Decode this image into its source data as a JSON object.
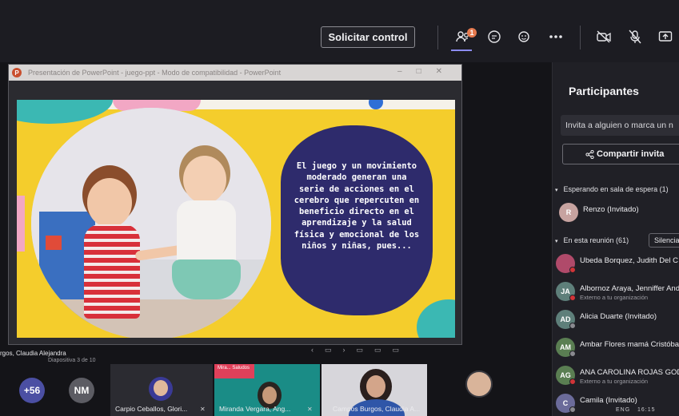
{
  "toolbar": {
    "request_control_label": "Solicitar control",
    "participants_badge": "1",
    "icons": [
      "people-icon",
      "chat-icon",
      "reactions-icon",
      "more-icon",
      "camera-off-icon",
      "mic-off-icon",
      "share-icon"
    ]
  },
  "powerpoint": {
    "title": "Presentación de PowerPoint - juego-ppt - Modo de compatibilidad - PowerPoint",
    "slide_text": "El juego y un movimiento moderado generan una serie de acciones en el cerebro que repercuten en beneficio directo en el aprendizaje y la salud física y emocional de los niños y niñas, pues...",
    "slide_counter": "Diapositiva 3 de 10",
    "presenter_name": "rgos, Claudia Alejandra"
  },
  "panel": {
    "title": "Participantes",
    "invite_placeholder": "Invita a alguien o marca un n",
    "share_invite_label": "Compartir invita",
    "waiting_section": "Esperando en sala de espera (1)",
    "in_meeting_section": "En esta reunión (61)",
    "mute_all_label": "Silencia",
    "waiting": [
      {
        "initials": "R",
        "name": "Renzo (Invitado)",
        "color": "#c7a3a0"
      }
    ],
    "participants": [
      {
        "initials": "",
        "name": "Ubeda Borquez, Judith Del C",
        "sub": "",
        "color": "#b04a6a",
        "presence": "#d13438"
      },
      {
        "initials": "JA",
        "name": "Albornoz Araya, Jenniffer And",
        "sub": "Externo a tu organización",
        "color": "#5e7f7a",
        "presence": "#d13438"
      },
      {
        "initials": "AD",
        "name": "Alicia Duarte (Invitado)",
        "sub": "",
        "color": "#5e7f7a",
        "presence": "#8a8a90"
      },
      {
        "initials": "AM",
        "name": "Ambar Flores mamá Cristóbal...",
        "sub": "",
        "color": "#5a7e52",
        "presence": "#8a8a90"
      },
      {
        "initials": "AG",
        "name": "ANA CAROLINA ROJAS GODOY",
        "sub": "Externo a tu organización",
        "color": "#5a7e52",
        "presence": "#d13438"
      },
      {
        "initials": "C",
        "name": "Camila (Invitado)",
        "sub": "",
        "color": "#6b6b9a",
        "presence": "#8a8a90"
      }
    ]
  },
  "strip": {
    "overflow_count": "+56",
    "nm_initials": "NM",
    "tiles": [
      {
        "name": "Carpio Ceballos, Glori..."
      },
      {
        "name": "Miranda Vergara, Ang..."
      },
      {
        "name": "Campos Burgos, Claudia A..."
      }
    ],
    "video_label": "Mira... Saludos"
  },
  "taskbar": {
    "lang": "ENG",
    "time": "16:15"
  },
  "colors": {
    "accent": "#8c8cf2",
    "slide_yellow": "#f4cd2c",
    "bubble_navy": "#2e2b6c",
    "teal": "#3bb8b3"
  }
}
